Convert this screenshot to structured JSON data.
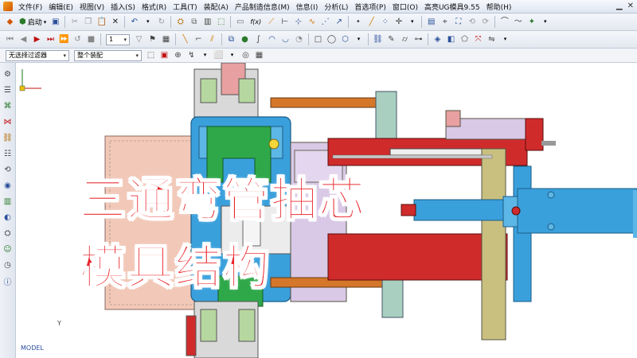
{
  "menubar": {
    "items": [
      "文件(F)",
      "编辑(E)",
      "视图(V)",
      "插入(S)",
      "格式(R)",
      "工具(T)",
      "装配(A)",
      "产品制造信息(M)",
      "信息(I)",
      "分析(L)",
      "首选项(P)",
      "窗口(O)",
      "高亮UG模具9.55",
      "帮助(H)"
    ]
  },
  "toolbar": {
    "start_label": "启动",
    "layer_value": "1",
    "fx_label": "f(x)"
  },
  "selection": {
    "filter_value": "无选择过滤器",
    "scope_value": "整个装配"
  },
  "overlay": {
    "line1": "三通弯管抽芯",
    "line2": "模具结构"
  },
  "viewport": {
    "axis_y": "Y",
    "model_label": "MODEL"
  },
  "colors": {
    "overlay_text": "#e8232a",
    "blue_plate": "#3aa0dc",
    "green_core": "#2fa84a",
    "red_block": "#d02b2b",
    "orange_rod": "#d4772a"
  }
}
